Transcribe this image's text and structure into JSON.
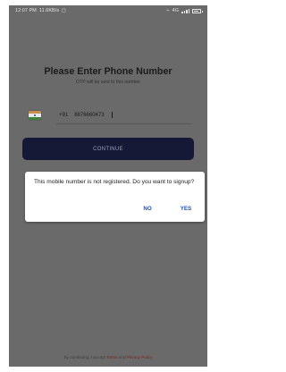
{
  "status_bar": {
    "time": "12:07 PM",
    "network_speed": "11.6KB/s",
    "signal_text": "4G"
  },
  "login": {
    "title": "Please Enter Phone Number",
    "subtitle": "OTP will be sent to this number",
    "country_code": "+91",
    "phone_value": "8876660473",
    "continue_label": "CONTINUE"
  },
  "dialog": {
    "message": "This mobile number is not registered. Do you want to signup?",
    "no_label": "NO",
    "yes_label": "YES"
  },
  "footer": {
    "prefix": "By continuing, I accept",
    "terms_link": "Terms",
    "and": "and",
    "privacy_link": "Privacy Policy"
  },
  "icons": {
    "flag": "india-flag-icon",
    "status": [
      "notification-icon",
      "wifi-icon",
      "signal-icon",
      "battery-icon"
    ]
  },
  "colors": {
    "overlay": "#6a6a6a",
    "button": "#151936",
    "dialog_action": "#1f4fae",
    "footer_link": "#7a2323"
  }
}
